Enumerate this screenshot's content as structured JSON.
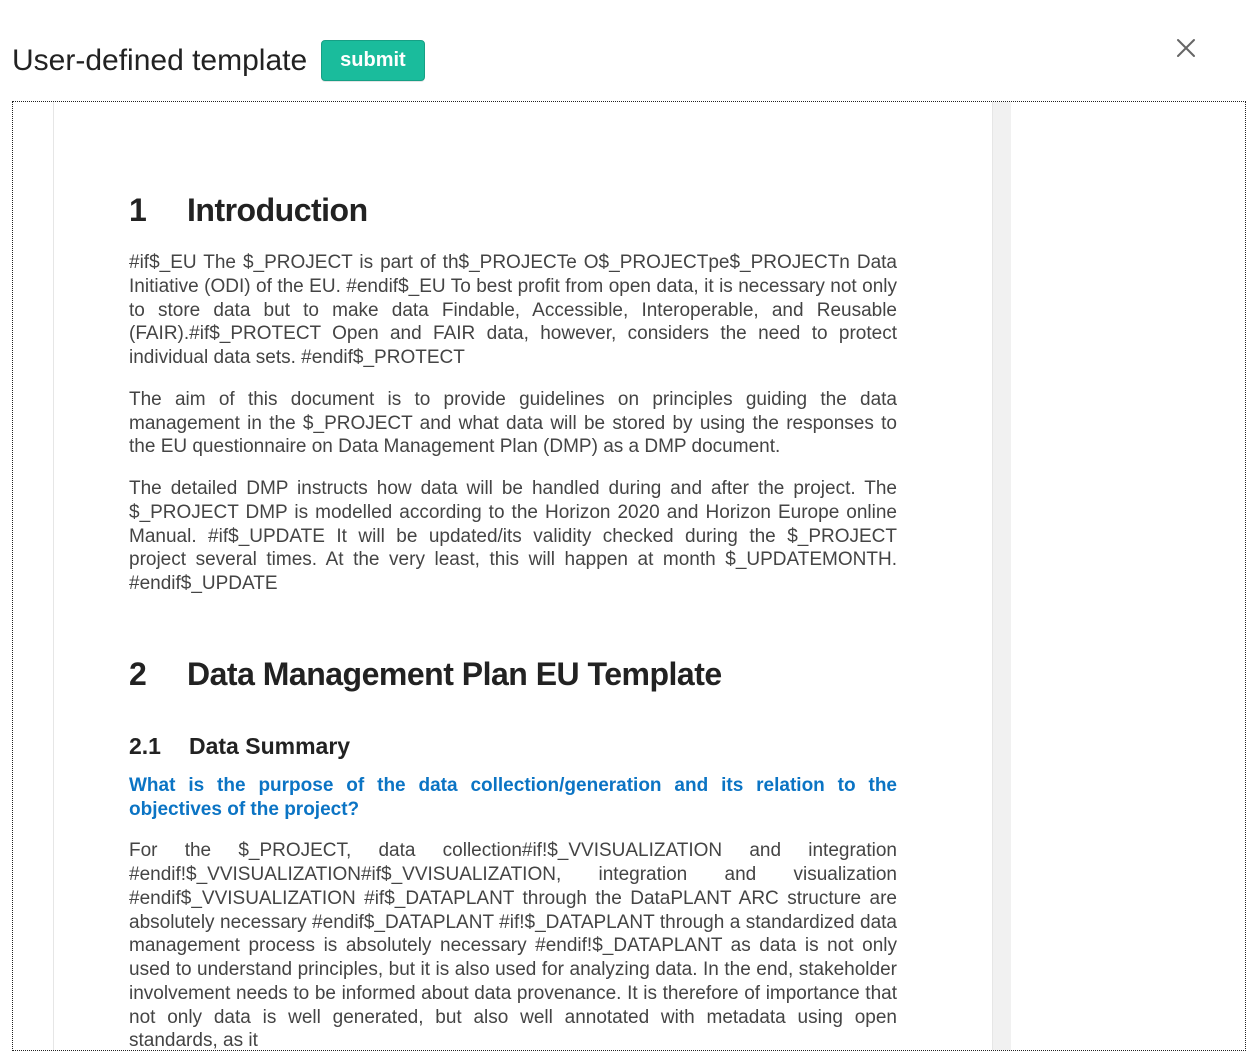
{
  "header": {
    "title": "User-defined template",
    "submit_label": "submit"
  },
  "document": {
    "section1": {
      "number": "1",
      "title": "Introduction",
      "para1": "#if$_EU The $_PROJECT is part of th$_PROJECTe O$_PROJECTpe$_PROJECTn Data Initiative (ODI) of the EU. #endif$_EU To best profit from open data, it is necessary not only to store data but to make data Findable, Accessible, Interoperable, and Reusable (FAIR).#if$_PROTECT Open and FAIR data, however, considers the need to protect individual data sets. #endif$_PROTECT",
      "para2": "The aim of this document is to provide guidelines on principles guiding the data management in the $_PROJECT and what data will be stored by using the responses to the EU questionnaire on Data Management Plan (DMP) as a DMP document.",
      "para3": "The detailed DMP instructs how data will be handled during and after the project. The $_PROJECT DMP is modelled according to the Horizon 2020 and Horizon Europe online Manual. #if$_UPDATE It will be updated/its validity checked during the $_PROJECT project several times. At the very least, this will happen at month $_UPDATEMONTH. #endif$_UPDATE"
    },
    "section2": {
      "number": "2",
      "title": "Data Management Plan EU Template",
      "sub1": {
        "number": "2.1",
        "title": "Data Summary",
        "question": "What is the purpose of the data collection/generation and its relation to the objectives of the project?",
        "para": "For the $_PROJECT, data collection#if!$_VVISUALIZATION and integration #endif!$_VVISUALIZATION#if$_VVISUALIZATION, integration and visualization #endif$_VVISUALIZATION #if$_DATAPLANT through the DataPLANT ARC structure are absolutely necessary #endif$_DATAPLANT #if!$_DATAPLANT through a standardized data management process is absolutely necessary #endif!$_DATAPLANT as data is not only used to understand principles, but it is also used for analyzing data. In the end, stakeholder involvement needs to be informed about data provenance. It is therefore of importance that not only data is well generated, but also well annotated with metadata using open standards, as it"
      }
    }
  }
}
